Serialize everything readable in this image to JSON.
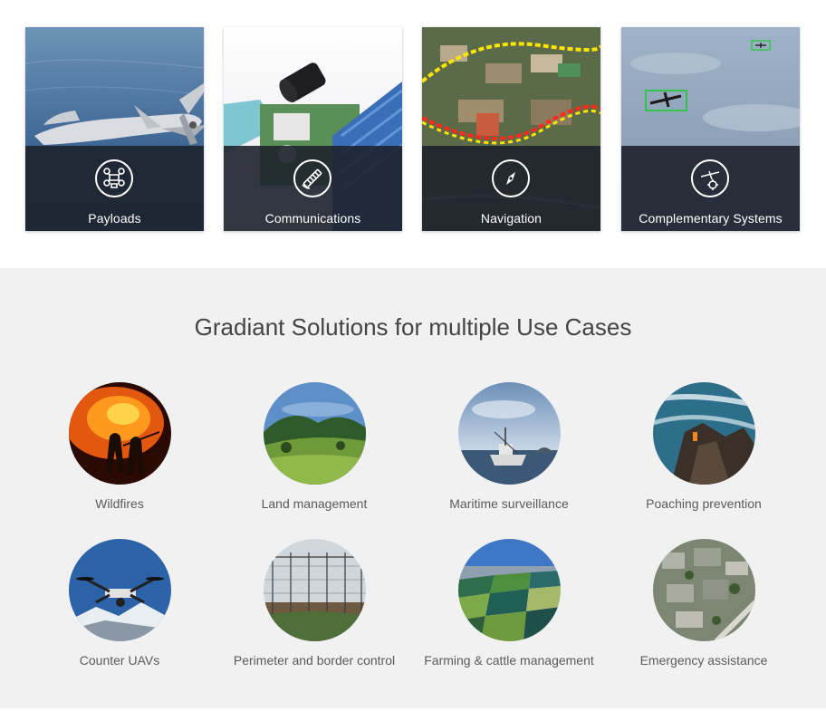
{
  "cards": [
    {
      "label": "Payloads",
      "icon": "drone-icon"
    },
    {
      "label": "Communications",
      "icon": "satellite-icon"
    },
    {
      "label": "Navigation",
      "icon": "compass-icon"
    },
    {
      "label": "Complementary Systems",
      "icon": "drone-target-icon"
    }
  ],
  "use_cases": {
    "title": "Gradiant Solutions for multiple Use Cases",
    "items": [
      {
        "label": "Wildfires"
      },
      {
        "label": "Land management"
      },
      {
        "label": "Maritime surveillance"
      },
      {
        "label": "Poaching prevention"
      },
      {
        "label": "Counter UAVs"
      },
      {
        "label": "Perimeter and border control"
      },
      {
        "label": "Farming & cattle management"
      },
      {
        "label": "Emergency assistance"
      }
    ]
  },
  "colors": {
    "card_overlay": "#1e222c",
    "section_background": "#f1f1f1",
    "title_text": "#444444",
    "label_text": "#5b5b5b"
  }
}
